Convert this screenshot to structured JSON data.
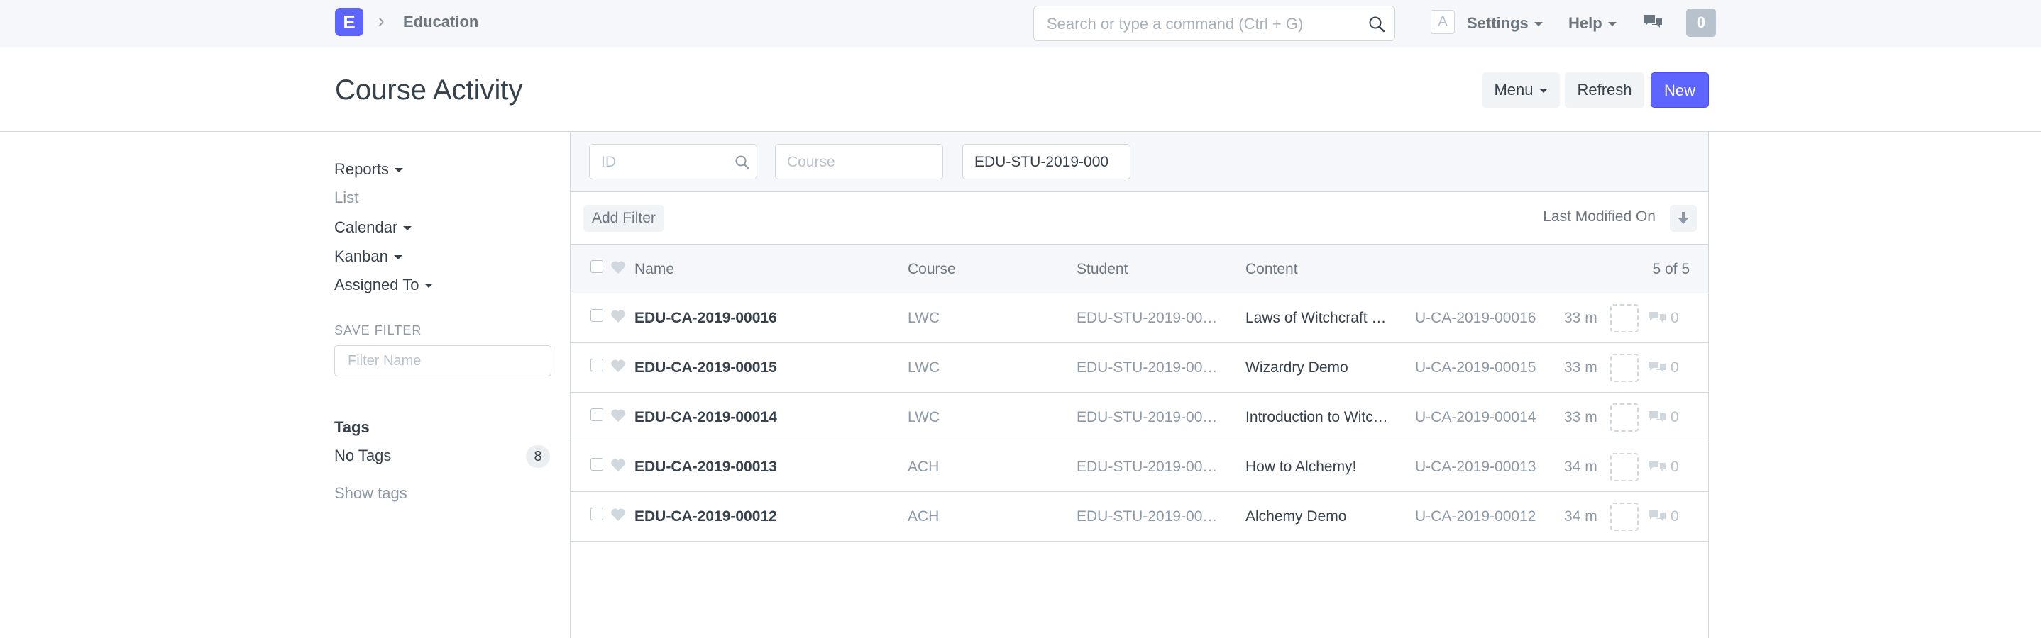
{
  "navbar": {
    "logo_letter": "E",
    "breadcrumb": "Education",
    "search_placeholder": "Search or type a command (Ctrl + G)",
    "avatar_letter": "A",
    "settings_label": "Settings",
    "help_label": "Help",
    "notification_count": "0"
  },
  "page": {
    "title": "Course Activity",
    "menu_label": "Menu",
    "refresh_label": "Refresh",
    "new_label": "New"
  },
  "sidebar": {
    "links": [
      {
        "label": "Reports",
        "dropdown": true
      },
      {
        "label": "List",
        "dropdown": false
      },
      {
        "label": "Calendar",
        "dropdown": true
      },
      {
        "label": "Kanban",
        "dropdown": true
      },
      {
        "label": "Assigned To",
        "dropdown": true
      }
    ],
    "save_filter_label": "SAVE FILTER",
    "filter_name_placeholder": "Filter Name",
    "tags_label": "Tags",
    "no_tags_label": "No Tags",
    "no_tags_count": "8",
    "show_tags_label": "Show tags"
  },
  "filters": {
    "id_placeholder": "ID",
    "course_placeholder": "Course",
    "student_value": "EDU-STU-2019-000",
    "add_filter_label": "Add Filter",
    "sort_label": "Last Modified On"
  },
  "list": {
    "columns": {
      "name": "Name",
      "course": "Course",
      "student": "Student",
      "content": "Content"
    },
    "count_label": "5 of 5",
    "rows": [
      {
        "name": "EDU-CA-2019-00016",
        "course": "LWC",
        "student": "EDU-STU-2019-00…",
        "content": "Laws of Witchcraft …",
        "ucode": "U-CA-2019-00016",
        "modified": "33 m",
        "comments": "0"
      },
      {
        "name": "EDU-CA-2019-00015",
        "course": "LWC",
        "student": "EDU-STU-2019-00…",
        "content": "Wizardry Demo",
        "ucode": "U-CA-2019-00015",
        "modified": "33 m",
        "comments": "0"
      },
      {
        "name": "EDU-CA-2019-00014",
        "course": "LWC",
        "student": "EDU-STU-2019-00…",
        "content": "Introduction to Witc…",
        "ucode": "U-CA-2019-00014",
        "modified": "33 m",
        "comments": "0"
      },
      {
        "name": "EDU-CA-2019-00013",
        "course": "ACH",
        "student": "EDU-STU-2019-00…",
        "content": "How to Alchemy!",
        "ucode": "U-CA-2019-00013",
        "modified": "34 m",
        "comments": "0"
      },
      {
        "name": "EDU-CA-2019-00012",
        "course": "ACH",
        "student": "EDU-STU-2019-00…",
        "content": "Alchemy Demo",
        "ucode": "U-CA-2019-00012",
        "modified": "34 m",
        "comments": "0"
      }
    ]
  },
  "colors": {
    "primary": "#5e64ff",
    "border": "#d1d8dd",
    "muted_text": "#8d99a6",
    "text": "#36414c",
    "light_bg": "#f5f7fa"
  },
  "icons": {
    "search": "search-icon",
    "chevron": "chevron-right-icon",
    "notifications": "comments-icon",
    "sort": "arrow-down-icon",
    "like": "heart-icon",
    "comment": "comment-icon"
  }
}
